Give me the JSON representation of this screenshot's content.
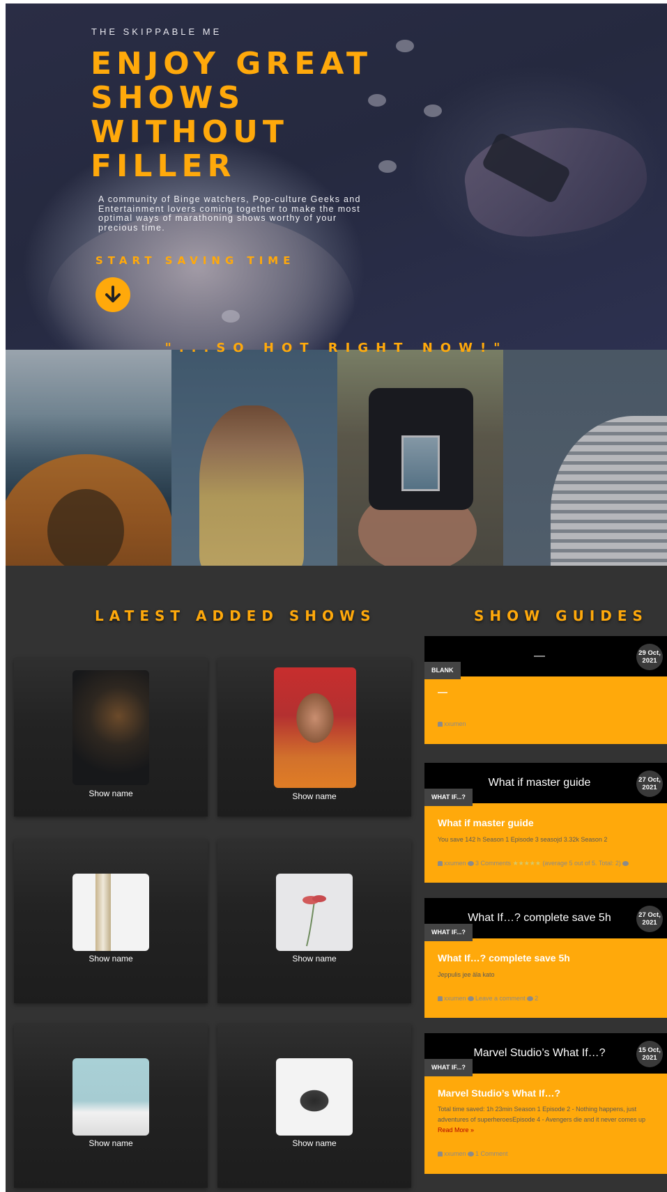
{
  "hero": {
    "eyebrow": "THE SKIPPABLE ME",
    "title_lines": [
      "ENJOY GREAT",
      "SHOWS",
      "WITHOUT",
      "FILLER"
    ],
    "description": "A community of Binge watchers, Pop-culture Geeks and Entertainment lovers coming together to make the most optimal ways of marathoning shows worthy of your precious time.",
    "cta": "START SAVING TIME"
  },
  "hot": {
    "title": "\"...SO HOT RIGHT NOW!\""
  },
  "latest": {
    "title": "LATEST ADDED SHOWS",
    "shows": [
      {
        "name": "Show name"
      },
      {
        "name": "Show name"
      },
      {
        "name": "Show name"
      },
      {
        "name": "Show name"
      },
      {
        "name": "Show name"
      },
      {
        "name": "Show name"
      }
    ]
  },
  "guides": {
    "title": "SHOW GUIDES",
    "items": [
      {
        "header": "—",
        "date": [
          "29 Oct,",
          "2021"
        ],
        "category": "BLANK",
        "title": "—",
        "excerpt": "",
        "meta": {
          "author": "xxumen"
        }
      },
      {
        "header": "What if master guide",
        "date": [
          "27 Oct,",
          "2021"
        ],
        "category": "WHAT IF...?",
        "title": "What if master guide",
        "excerpt": "You save 142 h Season 1 Episode 3 seasojd 3.32k Season 2",
        "meta": {
          "author": "xxumen",
          "comments": "3 Comments",
          "stars": "★★★★★",
          "rating": "(average 5 out of 5. Total: 2)"
        }
      },
      {
        "header": "What If…? complete save 5h",
        "date": [
          "27 Oct,",
          "2021"
        ],
        "category": "WHAT IF...?",
        "title": "What If…? complete save 5h",
        "excerpt": "Jeppulis jee äla kato",
        "meta": {
          "author": "xxumen",
          "comments": "Leave a comment",
          "count": "2"
        }
      },
      {
        "header": "Marvel Studio’s What If…?",
        "date": [
          "15 Oct,",
          "2021"
        ],
        "category": "WHAT IF...?",
        "title": "Marvel Studio’s What If…?",
        "excerpt": "Total time saved: 1h 23min Season 1 Episode 2 - Nothing happens, just adventures of superheroesEpisode 4 - Avengers die and it never comes up",
        "read_more": "Read More »",
        "meta": {
          "author": "xxumen",
          "comments": "1 Comment"
        }
      }
    ]
  },
  "colors": {
    "accent": "#ffa90b",
    "dark_bg": "#333333",
    "card_black": "#000000"
  }
}
